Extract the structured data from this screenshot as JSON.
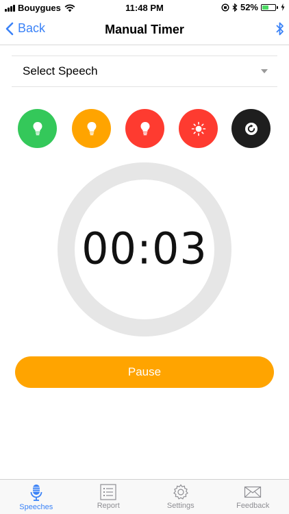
{
  "status_bar": {
    "carrier": "Bouygues",
    "time": "11:48 PM",
    "battery_percent": "52%",
    "battery_level": 0.52
  },
  "nav": {
    "back_label": "Back",
    "title": "Manual Timer"
  },
  "speech_select": {
    "value": "Select Speech"
  },
  "actions": [
    {
      "name": "green-light",
      "color": "#34c85a",
      "icon": "lightbulb-icon"
    },
    {
      "name": "yellow-light",
      "color": "#ffa400",
      "icon": "lightbulb-icon"
    },
    {
      "name": "red-light",
      "color": "#fe3b30",
      "icon": "lightbulb-icon"
    },
    {
      "name": "flash-light",
      "color": "#fe3b30",
      "icon": "sun-icon"
    },
    {
      "name": "reset",
      "color": "#1e1e1e",
      "icon": "reset-icon"
    }
  ],
  "timer": {
    "display": "00:03"
  },
  "pause_button": {
    "label": "Pause",
    "color": "#ffa400"
  },
  "tabs": [
    {
      "label": "Speeches",
      "icon": "microphone-icon",
      "active": true
    },
    {
      "label": "Report",
      "icon": "list-icon",
      "active": false
    },
    {
      "label": "Settings",
      "icon": "gear-icon",
      "active": false
    },
    {
      "label": "Feedback",
      "icon": "envelope-icon",
      "active": false
    }
  ],
  "colors": {
    "accent": "#3a82f7",
    "inactive": "#8e8e93"
  }
}
